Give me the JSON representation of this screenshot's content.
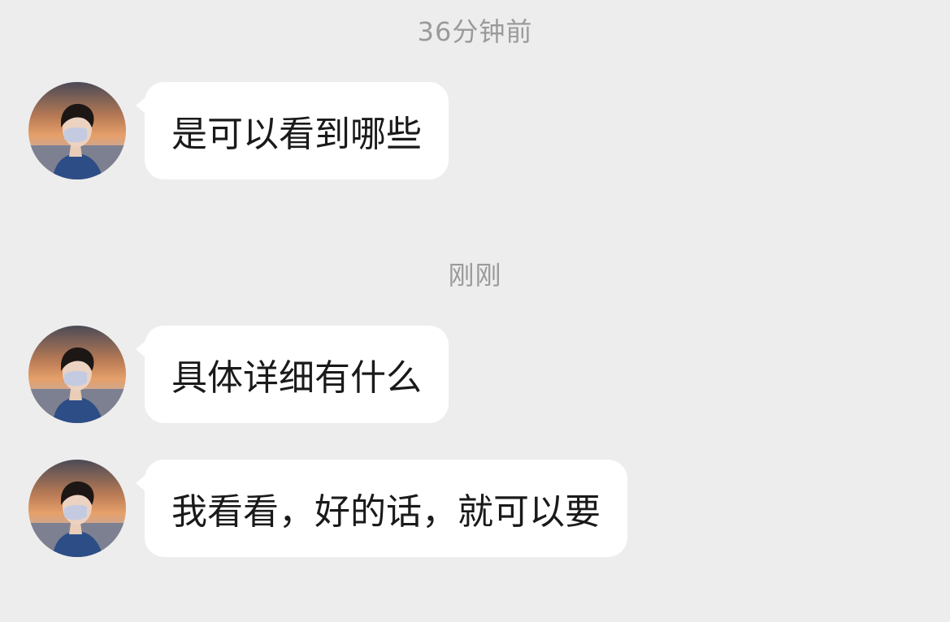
{
  "timestamps": {
    "first": "36分钟前",
    "second": "刚刚"
  },
  "messages": [
    {
      "text": "是可以看到哪些",
      "avatar": "avatar-photo"
    },
    {
      "text": "具体详细有什么",
      "avatar": "avatar-photo"
    },
    {
      "text": "我看看，好的话，就可以要",
      "avatar": "avatar-photo"
    }
  ],
  "colors": {
    "background": "#ededed",
    "bubble": "#ffffff",
    "timestamp_text": "#9a9a9a",
    "message_text": "#1a1a1a"
  }
}
